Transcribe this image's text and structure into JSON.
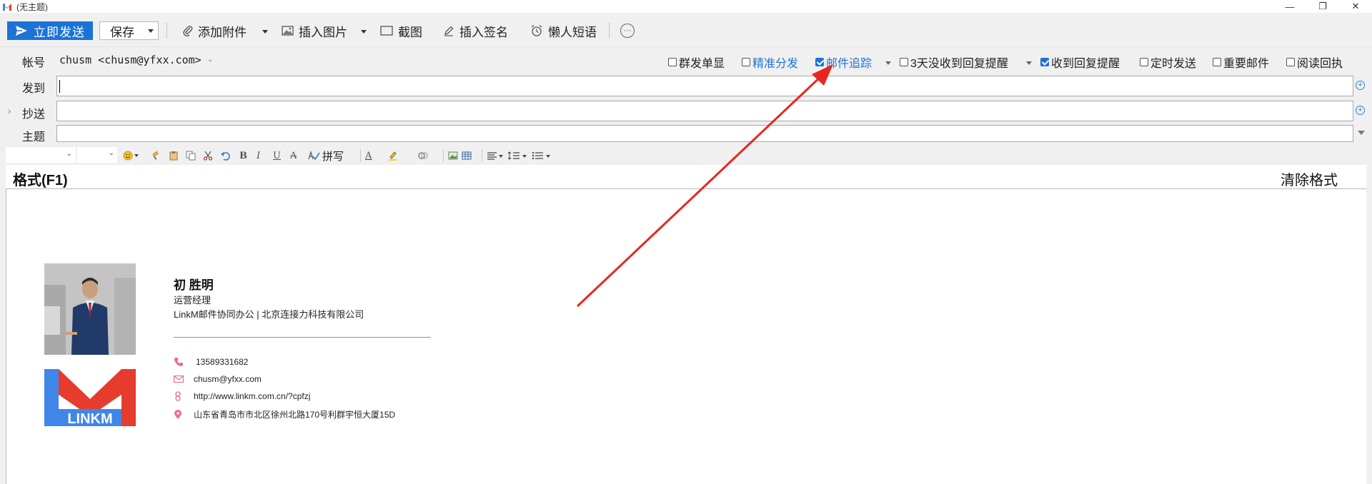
{
  "window": {
    "title": "(无主题)",
    "controls": [
      "—",
      "❐",
      "✕"
    ]
  },
  "toolbar": {
    "send_label": "立即发送",
    "save_label": "保存",
    "attach_label": "添加附件",
    "insert_image_label": "插入图片",
    "screenshot_label": "截图",
    "signature_label": "插入签名",
    "quick_phrase_label": "懒人短语",
    "more_label": "···"
  },
  "account": {
    "label": "帐号",
    "value": "chusm <chusm@yfxx.com>"
  },
  "options": {
    "group_single": "群发单显",
    "precise_send": "精准分发",
    "mail_tracking": "邮件追踪",
    "no_reply_3days": "3天没收到回复提醒",
    "reply_notify": "收到回复提醒",
    "scheduled_send": "定时发送",
    "important": "重要邮件",
    "read_receipt": "阅读回执",
    "checked": {
      "mail_tracking": true,
      "reply_notify": true
    }
  },
  "fields": {
    "to_label": "发到",
    "cc_label": "抄送",
    "subject_label": "主题"
  },
  "format_toolbar": {
    "spell_label": "拼写"
  },
  "format_header": {
    "title": "格式(F1)",
    "clear_label": "清除格式"
  },
  "signature": {
    "name": "初 胜明",
    "title": "运营经理",
    "company": "LinkM邮件协同办公 | 北京连接力科技有限公司",
    "phone": "13589331682",
    "email": "chusm@yfxx.com",
    "url": "http://www.linkm.com.cn/?cpfzj",
    "address": "山东省青岛市市北区徐州北路170号利群宇恒大厦15D",
    "logo_text": "LINKM",
    "accent_color": "#ef6a86"
  },
  "colors": {
    "primary": "#1c73d6",
    "arrow": "#e8261f",
    "logo_red": "#e53c2e",
    "logo_blue": "#3f86e8"
  }
}
